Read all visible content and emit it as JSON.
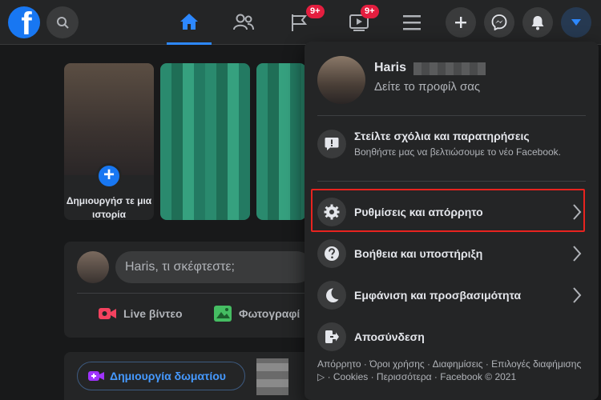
{
  "topbar": {
    "logo_letter": "f",
    "badges": {
      "flag": "9+",
      "video": "9+"
    }
  },
  "feed": {
    "create_story_label": "Δημιουργήσ τε μια ιστορία",
    "composer_placeholder": "Haris, τι σκέφτεστε;",
    "live_video_label": "Live βίντεο",
    "photo_label": "Φωτογραφί",
    "create_room_label": "Δημιουργία δωματίου"
  },
  "menu": {
    "profile_name": "Haris",
    "profile_sub": "Δείτε το προφίλ σας",
    "feedback_title": "Στείλτε σχόλια και παρατηρήσεις",
    "feedback_desc": "Βοηθήστε μας να βελτιώσουμε το νέο Facebook.",
    "settings_label": "Ρυθμίσεις και απόρρητο",
    "help_label": "Βοήθεια και υποστήριξη",
    "display_label": "Εμφάνιση και προσβασιμότητα",
    "logout_label": "Αποσύνδεση",
    "footer": "Απόρρητο · Όροι χρήσης · Διαφημίσεις · Επιλογές διαφήμισης ▷ · Cookies · Περισσότερα · Facebook © 2021"
  },
  "colors": {
    "accent": "#1877f2",
    "badge": "#e41e3f",
    "highlight": "#e8231f"
  }
}
